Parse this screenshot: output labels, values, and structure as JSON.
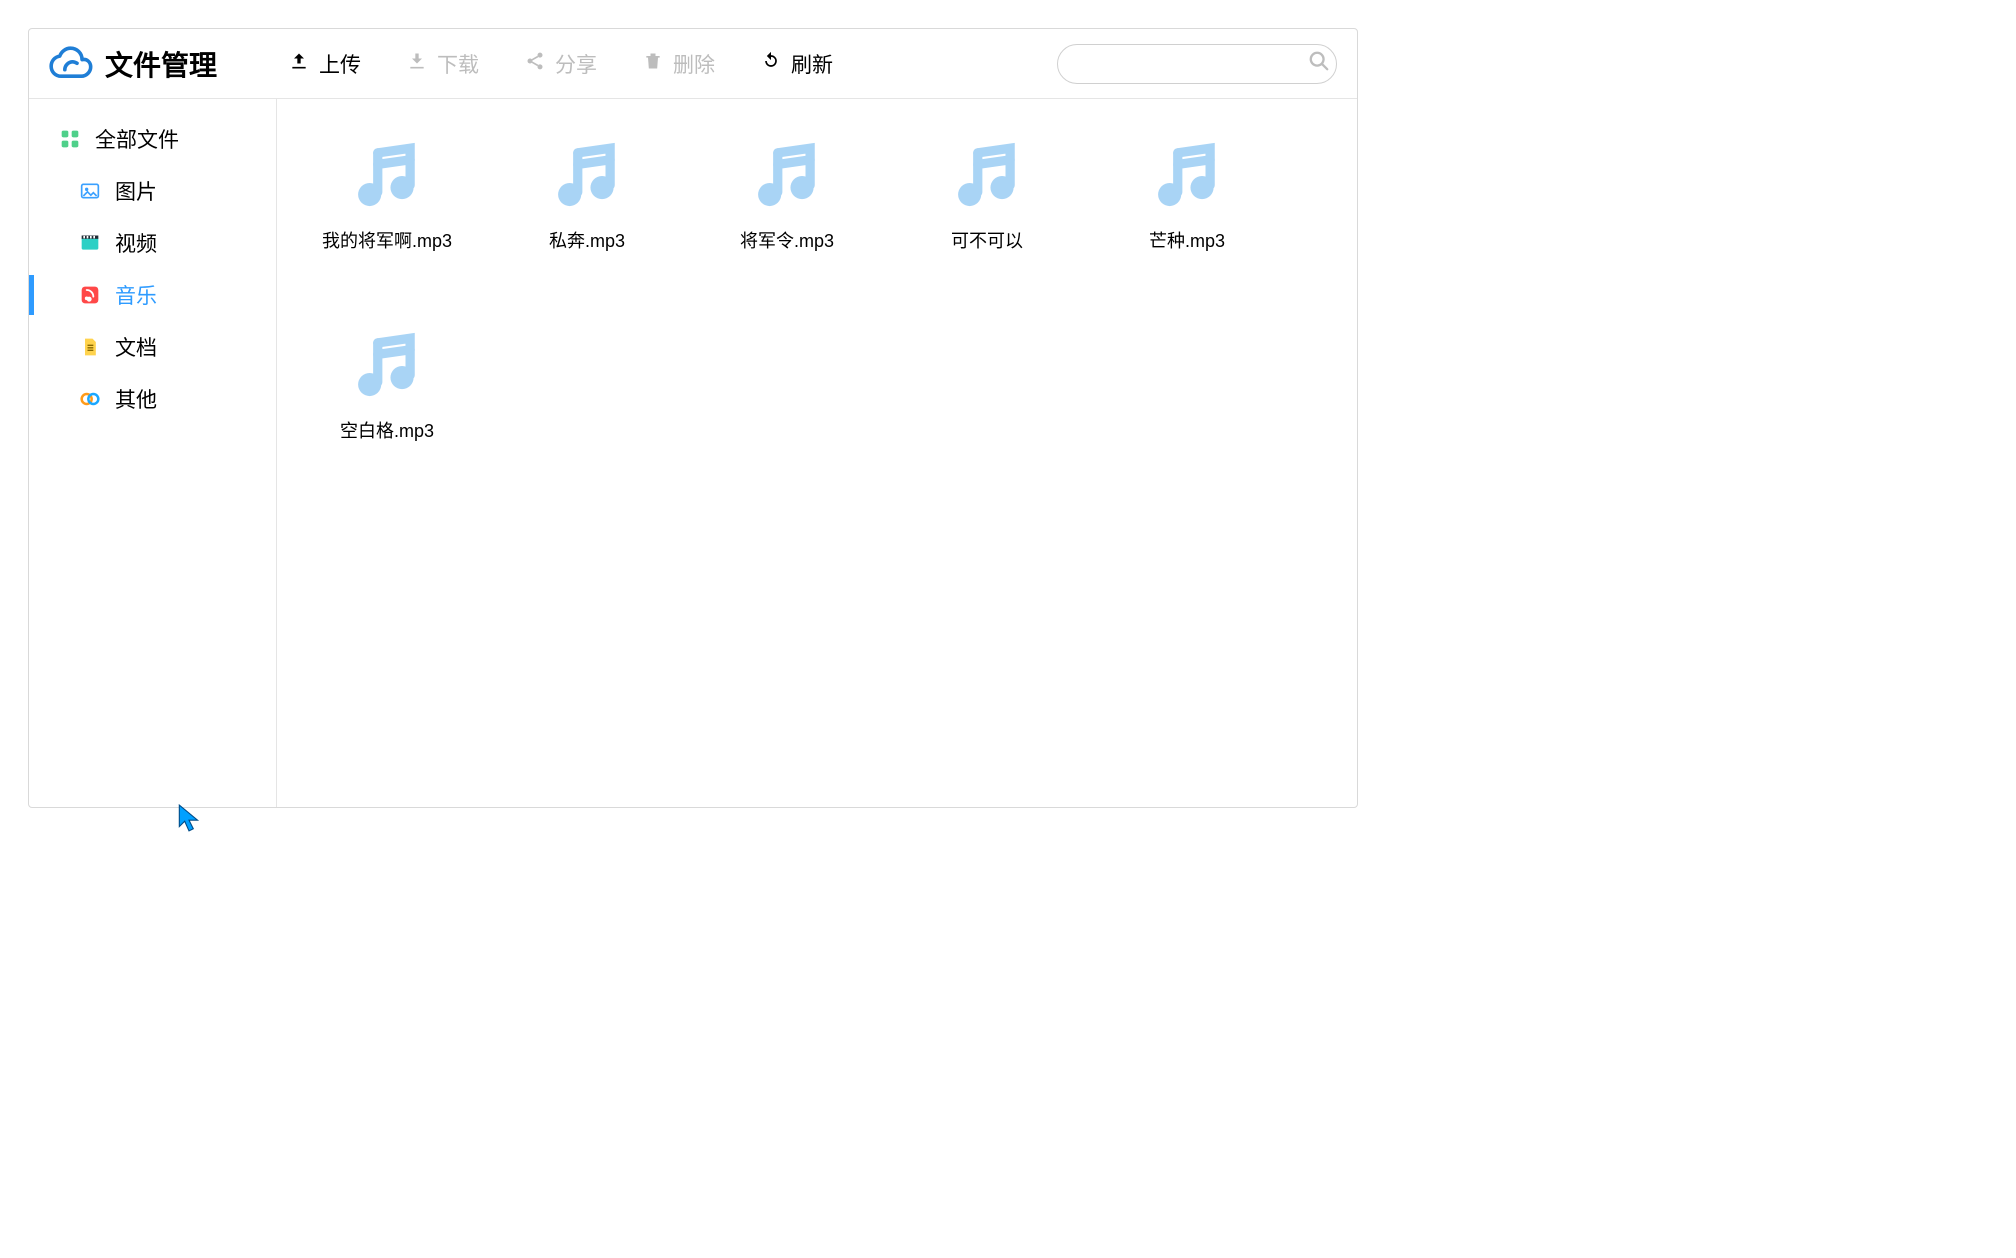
{
  "brand": {
    "title": "文件管理"
  },
  "toolbar": {
    "upload": "上传",
    "download": "下载",
    "share": "分享",
    "delete": "删除",
    "refresh": "刷新",
    "search_placeholder": ""
  },
  "sidebar": {
    "items": [
      {
        "id": "all",
        "label": "全部文件",
        "icon": "grid",
        "sub": false,
        "active": false
      },
      {
        "id": "image",
        "label": "图片",
        "icon": "image",
        "sub": true,
        "active": false
      },
      {
        "id": "video",
        "label": "视频",
        "icon": "video",
        "sub": true,
        "active": false
      },
      {
        "id": "music",
        "label": "音乐",
        "icon": "music",
        "sub": true,
        "active": true
      },
      {
        "id": "doc",
        "label": "文档",
        "icon": "doc",
        "sub": true,
        "active": false
      },
      {
        "id": "other",
        "label": "其他",
        "icon": "other",
        "sub": true,
        "active": false
      }
    ]
  },
  "files": [
    {
      "name": "我的将军啊.mp3",
      "type": "music"
    },
    {
      "name": "私奔.mp3",
      "type": "music"
    },
    {
      "name": "将军令.mp3",
      "type": "music"
    },
    {
      "name": "可不可以",
      "type": "music"
    },
    {
      "name": "芒种.mp3",
      "type": "music"
    },
    {
      "name": "空白格.mp3",
      "type": "music"
    }
  ]
}
